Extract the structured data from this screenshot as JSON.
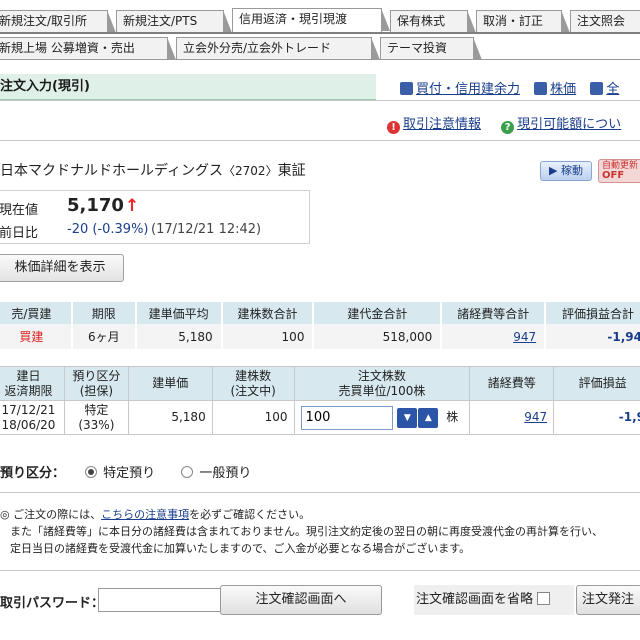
{
  "tabs_row1": [
    "新規注文/取引所",
    "新規注文/PTS",
    "信用返済・現引現渡",
    "保有株式",
    "取消・訂正",
    "注文照会"
  ],
  "tabs_row2": [
    "新規上場 公募増資・売出",
    "立会外分売/立会外トレード",
    "テーマ投資"
  ],
  "header": {
    "title": "注文入力(現引)",
    "links": [
      "買付・信用建余力",
      "株価",
      "全"
    ]
  },
  "notices": [
    "取引注意情報",
    "現引可能額につい"
  ],
  "stock": {
    "name": "日本マクドナルドホールディングス",
    "code": "〈2702〉",
    "market": "東証",
    "move_button": "稼動",
    "auto_label_top": "自動更新",
    "auto_label_bottom": "OFF"
  },
  "price": {
    "current_label": "現在値",
    "current": "5,170",
    "arrow": "↑",
    "change_label": "前日比",
    "change": "-20 (-0.39%)",
    "timestamp": "(17/12/21 12:42)"
  },
  "detail_button": "株価詳細を表示",
  "summary_table": {
    "headers": [
      "売/買建",
      "期限",
      "建単価平均",
      "建株数合計",
      "建代金合計",
      "諸経費等合計",
      "評価損益合計"
    ],
    "row": {
      "side": "買建",
      "term": "6ヶ月",
      "avg_price": "5,180",
      "qty": "100",
      "amount": "518,000",
      "fees": "947",
      "pnl": "-1,94"
    }
  },
  "position_table": {
    "headers": [
      [
        "建日",
        "返済期限"
      ],
      [
        "預り区分",
        "(担保)"
      ],
      [
        "建単価"
      ],
      [
        "建株数",
        "(注文中)"
      ],
      [
        "注文株数",
        "売買単位/100株"
      ],
      [
        "諸経費等"
      ],
      [
        "評価損益"
      ]
    ],
    "row": {
      "open_date": "17/12/21",
      "due_date": "18/06/20",
      "deposit": "特定",
      "deposit_pct": "(33%)",
      "price": "5,180",
      "qty": "100",
      "order_qty": "100",
      "unit": "株",
      "fees": "947",
      "pnl": "-1,9"
    }
  },
  "deposit": {
    "label": "預り区分：",
    "option1": "特定預り",
    "option2": "一般預り"
  },
  "notes": {
    "line1_pre": "ご注文の際には、",
    "line1_link": "こちらの注意事項",
    "line1_post": "を必ずご確認ください。",
    "line2": "また「諸経費等」に本日分の諸経費は含まれておりません。現引注文約定後の翌日の朝に再度受渡代金の再計算を行い、",
    "line3": "定日当日の諸経費を受渡代金に加算いたしますので、ご入金が必要となる場合がございます。"
  },
  "footer": {
    "password_label": "取引パスワード：",
    "confirm_button": "注文確認画面へ",
    "skip_label": "注文確認画面を省略",
    "send_button": "注文発注"
  }
}
